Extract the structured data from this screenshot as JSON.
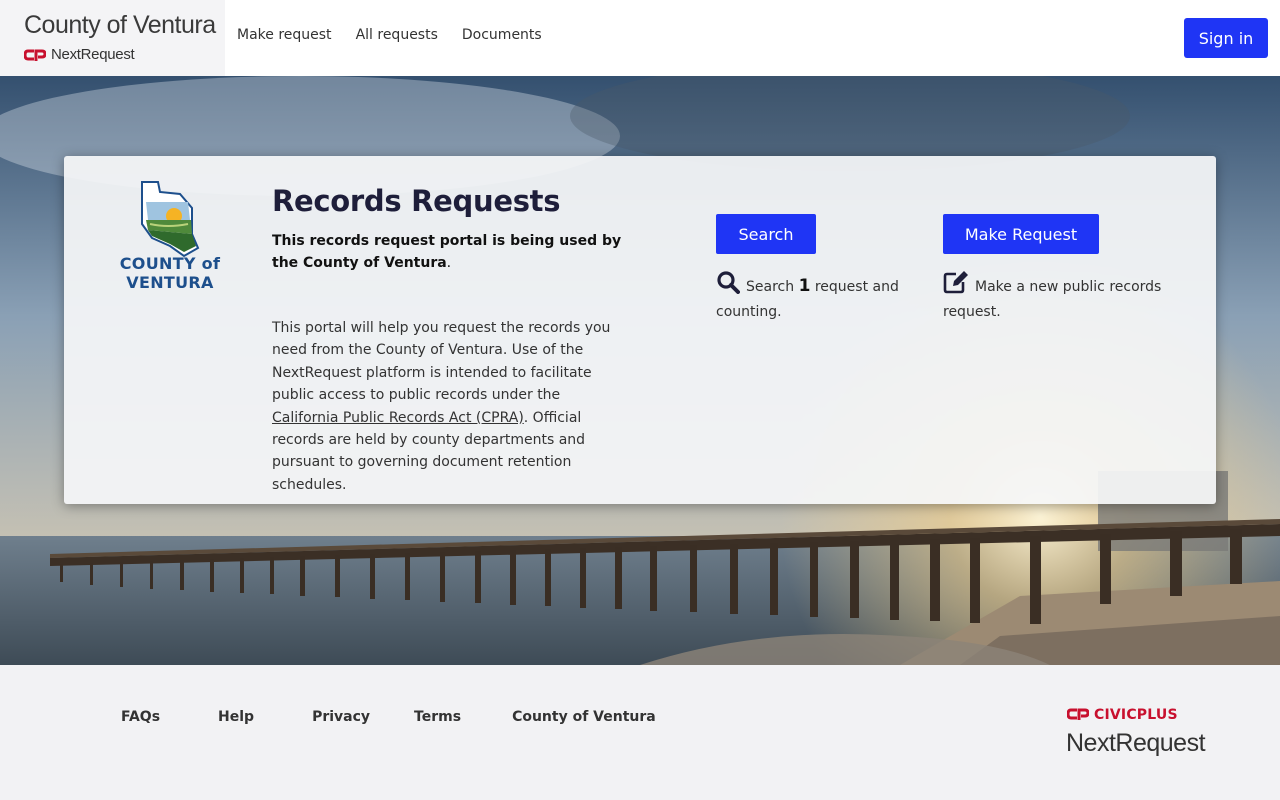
{
  "header": {
    "brand_title": "County of Ventura",
    "brand_sub": "NextRequest",
    "nav": [
      "Make request",
      "All requests",
      "Documents"
    ],
    "signin_label": "Sign in"
  },
  "card": {
    "seal_text": "COUNTY of VENTURA",
    "title": "Records Requests",
    "lead_bold": "This records request portal is being used by the County of Ventura",
    "lead_end": ".",
    "desc_pre": "This portal will help you request the records you need from the County of Ventura. Use of the NextRequest platform is intended to facilitate public access to public records under the ",
    "desc_link": "California Public Records Act (CPRA)",
    "desc_post": ". Official records are held by county departments and pursuant to governing document retention schedules.",
    "search_button": "Search",
    "search_pre": "Search ",
    "search_count": "1",
    "search_post": " request and counting.",
    "make_button": "Make Request",
    "make_text": "Make a new public records request."
  },
  "footer": {
    "links": [
      "FAQs",
      "Help",
      "Privacy",
      "Terms",
      "County of Ventura"
    ],
    "civic_label": "CIVICPLUS",
    "nextrequest_label": "NextRequest"
  },
  "colors": {
    "primary_button": "#1f35f5",
    "civicplus_red": "#c8102e"
  },
  "icons": [
    "civicplus-logo-icon",
    "county-seal-icon",
    "search-icon",
    "edit-icon"
  ]
}
